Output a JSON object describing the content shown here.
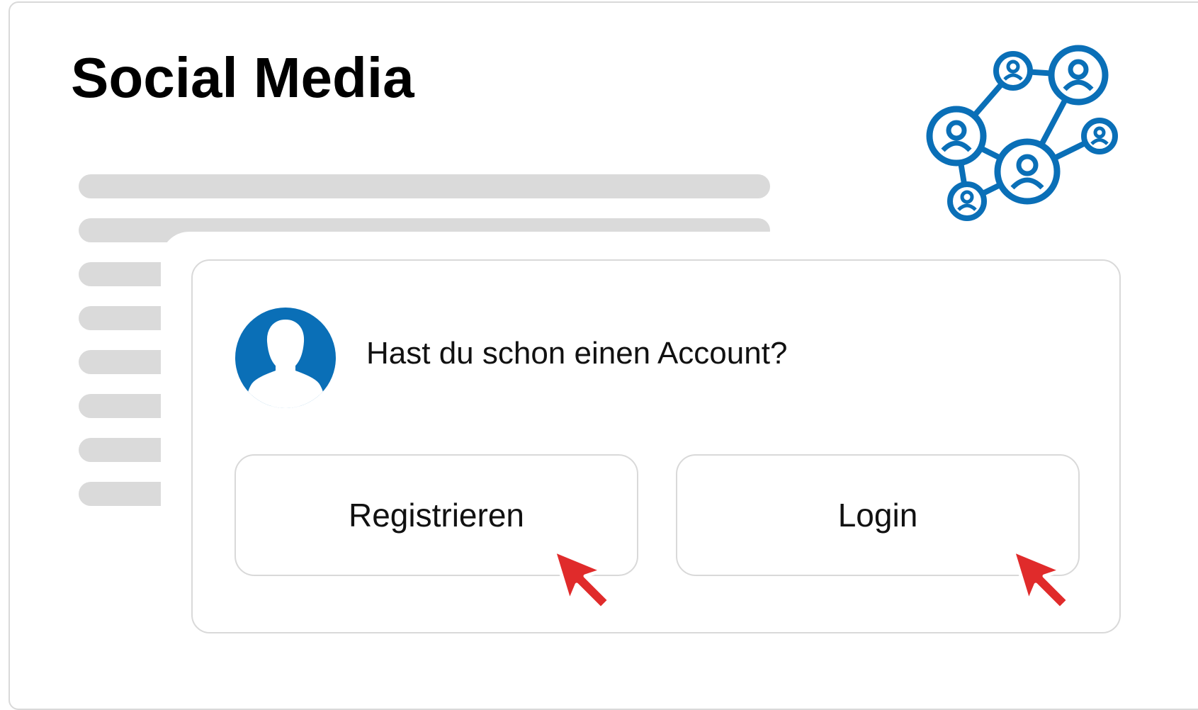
{
  "header": {
    "title": "Social Media"
  },
  "icons": {
    "network": "social-network-icon",
    "avatar": "user-avatar-icon",
    "cursor": "mouse-pointer-icon"
  },
  "dialog": {
    "question": "Hast du schon einen Account?",
    "register_label": "Registrieren",
    "login_label": "Login"
  },
  "colors": {
    "accent": "#0a6fb7",
    "cursor": "#e02b2b",
    "placeholder": "#dadada",
    "border": "#d9d9d9"
  }
}
